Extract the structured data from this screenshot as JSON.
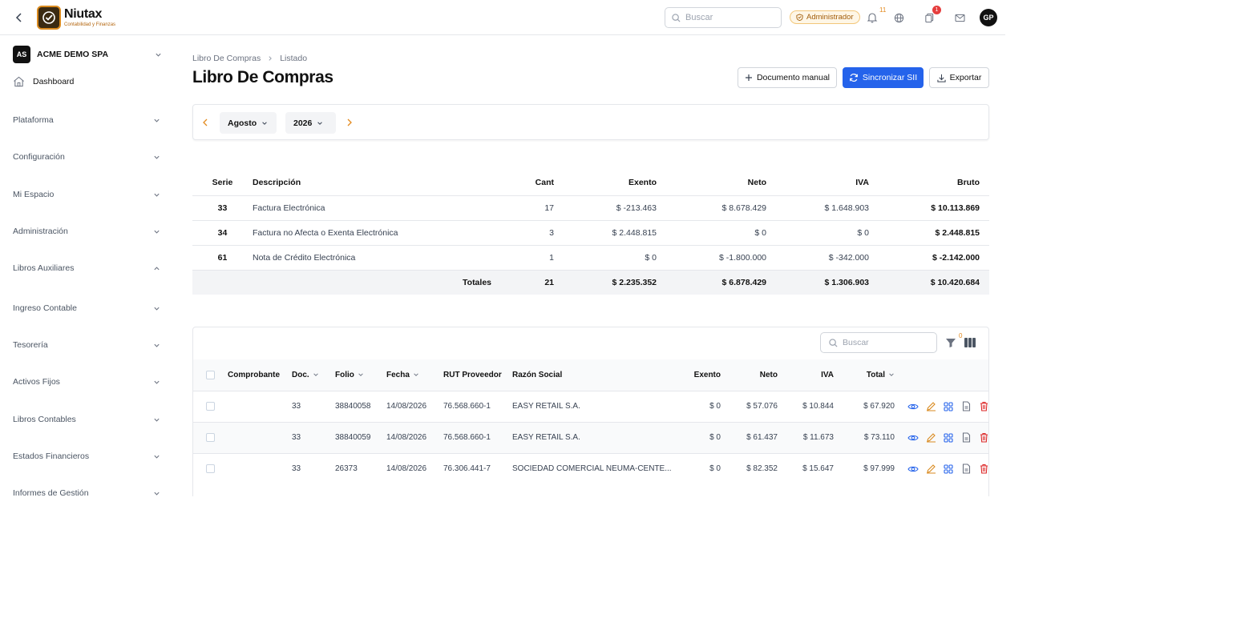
{
  "app": {
    "logo_name": "Niutax",
    "logo_sub": "Contabilidad y Finanzas"
  },
  "topbar": {
    "search_placeholder": "Buscar",
    "role_badge": "Administrador",
    "notifications_count": "11",
    "tasks_count": "1",
    "avatar_initials": "GP"
  },
  "sidebar": {
    "company_initials": "AS",
    "company_name": "ACME DEMO SPA",
    "dashboard": "Dashboard",
    "items": [
      {
        "label": "Plataforma",
        "expanded": false
      },
      {
        "label": "Configuración",
        "expanded": false
      },
      {
        "label": "Mi Espacio",
        "expanded": false
      },
      {
        "label": "Administración",
        "expanded": false
      },
      {
        "label": "Libros Auxiliares",
        "expanded": true
      },
      {
        "label": "Ingreso Contable",
        "expanded": false
      },
      {
        "label": "Tesorería",
        "expanded": false
      },
      {
        "label": "Activos Fijos",
        "expanded": false
      },
      {
        "label": "Libros Contables",
        "expanded": false
      },
      {
        "label": "Estados Financieros",
        "expanded": false
      },
      {
        "label": "Informes de Gestión",
        "expanded": false
      }
    ]
  },
  "breadcrumb": {
    "root": "Libro De Compras",
    "current": "Listado"
  },
  "page": {
    "title": "Libro De Compras"
  },
  "actions": {
    "manual": "Documento manual",
    "sync": "Sincronizar SII",
    "export": "Exportar"
  },
  "period": {
    "month": "Agosto",
    "year": "2026"
  },
  "summary": {
    "headers": {
      "serie": "Serie",
      "desc": "Descripción",
      "cant": "Cant",
      "exento": "Exento",
      "neto": "Neto",
      "iva": "IVA",
      "bruto": "Bruto"
    },
    "rows": [
      {
        "serie": "33",
        "desc": "Factura Electrónica",
        "cant": "17",
        "exento": "$ -213.463",
        "neto": "$ 8.678.429",
        "iva": "$ 1.648.903",
        "bruto": "$ 10.113.869"
      },
      {
        "serie": "34",
        "desc": "Factura no Afecta o Exenta Electrónica",
        "cant": "3",
        "exento": "$ 2.448.815",
        "neto": "$ 0",
        "iva": "$ 0",
        "bruto": "$ 2.448.815"
      },
      {
        "serie": "61",
        "desc": "Nota de Crédito Electrónica",
        "cant": "1",
        "exento": "$ 0",
        "neto": "$ -1.800.000",
        "iva": "$ -342.000",
        "bruto": "$ -2.142.000"
      }
    ],
    "totals": {
      "label": "Totales",
      "cant": "21",
      "exento": "$ 2.235.352",
      "neto": "$ 6.878.429",
      "iva": "$ 1.306.903",
      "bruto": "$ 10.420.684"
    }
  },
  "detail": {
    "search_placeholder": "Buscar",
    "filter_count": "0",
    "headers": {
      "comprobante": "Comprobante",
      "doc": "Doc.",
      "folio": "Folio",
      "fecha": "Fecha",
      "rut": "RUT Proveedor",
      "razon": "Razón Social",
      "exento": "Exento",
      "neto": "Neto",
      "iva": "IVA",
      "total": "Total"
    },
    "rows": [
      {
        "comprobante": "",
        "doc": "33",
        "folio": "38840058",
        "fecha": "14/08/2026",
        "rut": "76.568.660-1",
        "razon": "EASY RETAIL S.A.",
        "exento": "$ 0",
        "neto": "$ 57.076",
        "iva": "$ 10.844",
        "total": "$ 67.920"
      },
      {
        "comprobante": "",
        "doc": "33",
        "folio": "38840059",
        "fecha": "14/08/2026",
        "rut": "76.568.660-1",
        "razon": "EASY RETAIL S.A.",
        "exento": "$ 0",
        "neto": "$ 61.437",
        "iva": "$ 11.673",
        "total": "$ 73.110"
      },
      {
        "comprobante": "",
        "doc": "33",
        "folio": "26373",
        "fecha": "14/08/2026",
        "rut": "76.306.441-7",
        "razon": "SOCIEDAD COMERCIAL NEUMA-CENTE...",
        "exento": "$ 0",
        "neto": "$ 82.352",
        "iva": "$ 15.647",
        "total": "$ 97.999"
      }
    ]
  },
  "colors": {
    "primary": "#2563eb",
    "accent": "#d98a1f",
    "rut": "#c26a0e",
    "danger": "#e53e3e"
  }
}
